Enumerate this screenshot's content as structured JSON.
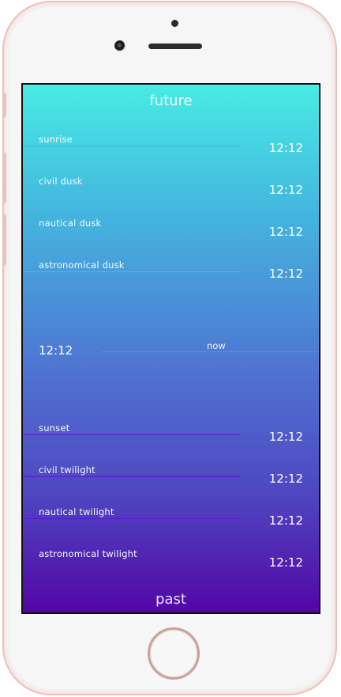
{
  "screen": {
    "top_label": "future",
    "bottom_label": "past"
  },
  "future_events": [
    {
      "label": "sunrise",
      "time": "12:12"
    },
    {
      "label": "civil dusk",
      "time": "12:12"
    },
    {
      "label": "nautical dusk",
      "time": "12:12"
    },
    {
      "label": "astronomical dusk",
      "time": "12:12"
    }
  ],
  "now": {
    "label": "now",
    "time": "12:12"
  },
  "past_events": [
    {
      "label": "sunset",
      "time": "12:12"
    },
    {
      "label": "civil twilight",
      "time": "12:12"
    },
    {
      "label": "nautical twilight",
      "time": "12:12"
    },
    {
      "label": "astronomical twilight",
      "time": "12:12"
    }
  ],
  "colors": {
    "gradient_top": "#48ebe3",
    "gradient_bottom": "#5306a6",
    "future_line": "#34c3e0",
    "past_line": "#5a1ad6",
    "now_line": "#d4646c",
    "frame_rose_gold": "#e7c2bd"
  }
}
